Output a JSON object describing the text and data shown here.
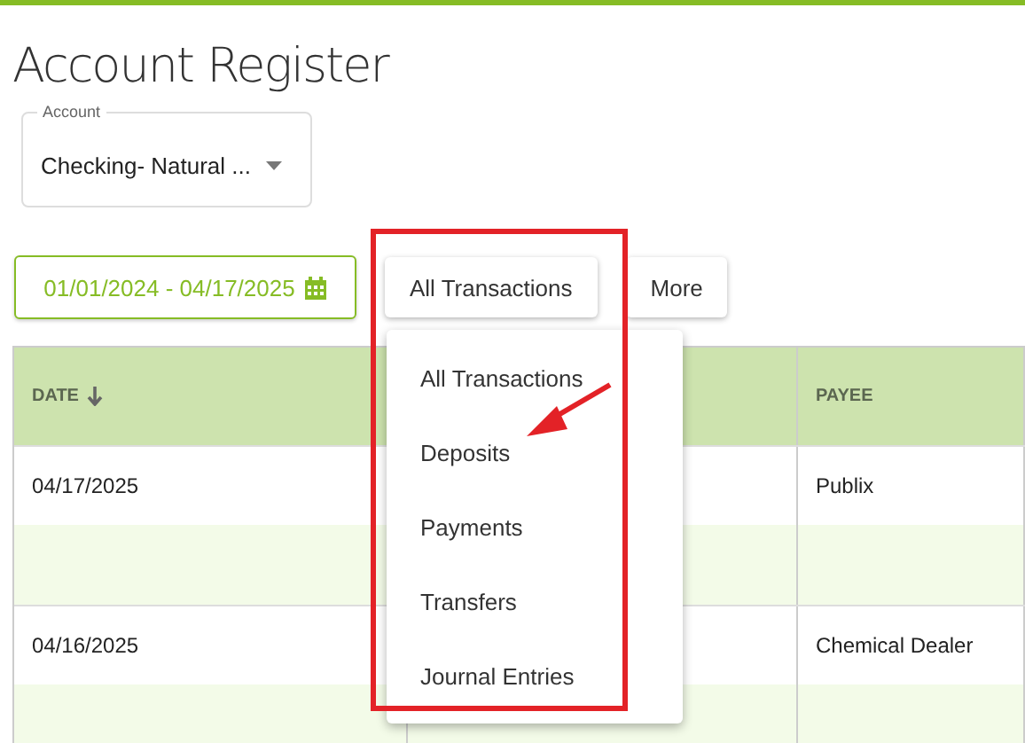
{
  "page": {
    "title": "Account Register"
  },
  "account_field": {
    "label": "Account",
    "value": "Checking- Natural ..."
  },
  "date_range": {
    "value": "01/01/2024 - 04/17/2025"
  },
  "filter_button": {
    "label": "All Transactions"
  },
  "more_button": {
    "label": "More"
  },
  "filter_menu": {
    "items": [
      {
        "label": "All Transactions",
        "selected": false
      },
      {
        "label": "Deposits",
        "selected": false
      },
      {
        "label": "Payments",
        "selected": false
      },
      {
        "label": "Transfers",
        "selected": false
      },
      {
        "label": "Journal Entries",
        "selected": false
      }
    ]
  },
  "table": {
    "columns": [
      {
        "label": "DATE",
        "sorted_descending": true
      },
      {
        "label": "PAYEE",
        "sorted_descending": false
      }
    ],
    "rows": [
      {
        "date": "04/17/2025",
        "payee": "Publix"
      },
      {
        "date": "04/16/2025",
        "payee": "Chemical Dealer"
      }
    ]
  },
  "annotation": {
    "highlight": true,
    "arrow": true
  }
}
